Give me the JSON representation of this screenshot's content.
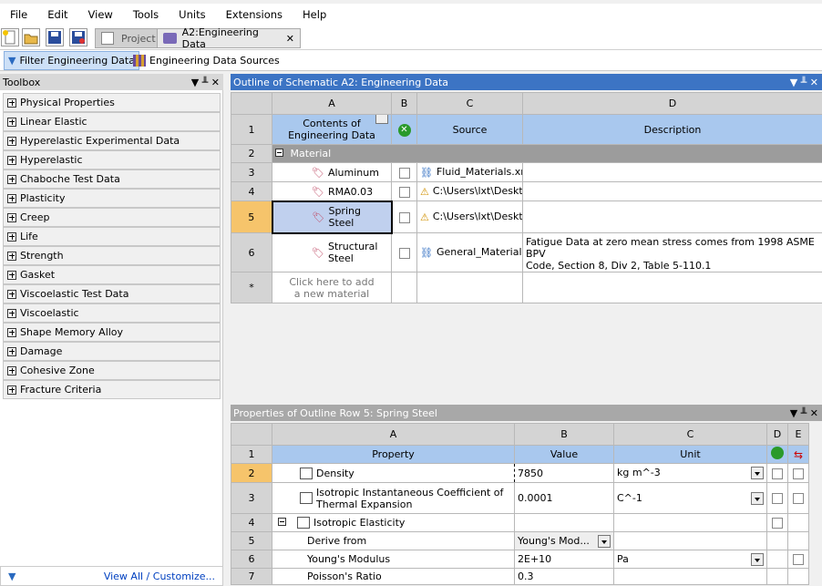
{
  "menu": [
    "File",
    "Edit",
    "View",
    "Tools",
    "Units",
    "Extensions",
    "Help"
  ],
  "tabs": {
    "project": "Project",
    "engdata": "A2:Engineering Data",
    "close": "✕"
  },
  "subbar": {
    "filter": "Filter Engineering Data",
    "sources": "Engineering Data Sources"
  },
  "toolbox": {
    "title": "Toolbox",
    "controls": {
      "pin": "▼ ╨ ✕"
    },
    "items": [
      "Physical Properties",
      "Linear Elastic",
      "Hyperelastic Experimental Data",
      "Hyperelastic",
      "Chaboche Test Data",
      "Plasticity",
      "Creep",
      "Life",
      "Strength",
      "Gasket",
      "Viscoelastic Test Data",
      "Viscoelastic",
      "Shape Memory Alloy",
      "Damage",
      "Cohesive Zone",
      "Fracture Criteria"
    ],
    "footer": "View All / Customize..."
  },
  "outline": {
    "title": "Outline of Schematic A2: Engineering Data",
    "controls": "▼ ╨ ✕",
    "cols": [
      "A",
      "B",
      "C",
      "D"
    ],
    "header": {
      "num": "1",
      "contents": "Contents of\nEngineering Data",
      "source": "Source",
      "description": "Description"
    },
    "group": {
      "num": "2",
      "label": "Material"
    },
    "rows": [
      {
        "num": "3",
        "name": "Aluminum",
        "source": "Fluid_Materials.xml",
        "desc": ""
      },
      {
        "num": "4",
        "name": "RMA0.03",
        "source": "C:\\Users\\lxt\\Deskt",
        "desc": ""
      },
      {
        "num": "5",
        "name": "Spring\nSteel",
        "source": "C:\\Users\\lxt\\Deskt",
        "desc": ""
      },
      {
        "num": "6",
        "name": "Structural\nSteel",
        "source": "General_Materials",
        "desc": "Fatigue Data at zero mean stress comes from 1998 ASME BPV\nCode, Section 8, Div 2, Table 5-110.1"
      }
    ],
    "newrow": {
      "num": "*",
      "text": "Click here to add\na new material"
    }
  },
  "properties": {
    "title": "Properties of Outline Row 5: Spring Steel",
    "controls": "▼ ╨ ✕",
    "cols": [
      "A",
      "B",
      "C",
      "D",
      "E"
    ],
    "header": {
      "num": "1",
      "property": "Property",
      "value": "Value",
      "unit": "Unit"
    },
    "rows": [
      {
        "num": "2",
        "property": "Density",
        "value": "7850",
        "unit": "kg m^-3"
      },
      {
        "num": "3",
        "property": "Isotropic Instantaneous Coefficient of\nThermal Expansion",
        "value": "0.0001",
        "unit": "C^-1"
      },
      {
        "num": "4",
        "property": "Isotropic Elasticity",
        "value": "",
        "unit": ""
      },
      {
        "num": "5",
        "property": "Derive from",
        "value": "Young's Mod...",
        "unit": ""
      },
      {
        "num": "6",
        "property": "Young's Modulus",
        "value": "2E+10",
        "unit": "Pa"
      },
      {
        "num": "7",
        "property": "Poisson's Ratio",
        "value": "0.3",
        "unit": ""
      }
    ]
  },
  "colors": {
    "accent": "#3c74c4",
    "selected": "#f6c46b",
    "fieldhdr": "#a9c8ee"
  }
}
